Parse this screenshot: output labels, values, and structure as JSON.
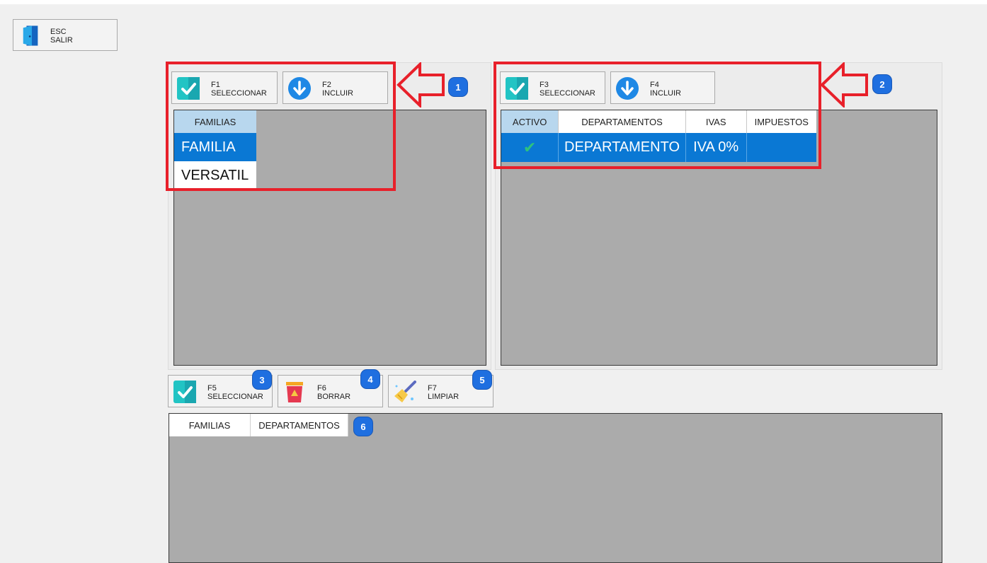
{
  "exit_button": {
    "key": "ESC",
    "label": "SALIR",
    "icon": "door-exit-icon"
  },
  "families_panel": {
    "select_button": {
      "key": "F1",
      "label": "SELECCIONAR",
      "icon": "check-icon"
    },
    "include_button": {
      "key": "F2",
      "label": "INCLUIR",
      "icon": "arrow-down-icon"
    },
    "table": {
      "header": "FAMILIAS",
      "rows": [
        "FAMILIA",
        "VERSATIL"
      ],
      "selected_index": 0
    }
  },
  "departments_panel": {
    "select_button": {
      "key": "F3",
      "label": "SELECCIONAR",
      "icon": "check-icon"
    },
    "include_button": {
      "key": "F4",
      "label": "INCLUIR",
      "icon": "arrow-down-icon"
    },
    "table": {
      "columns": [
        "ACTIVO",
        "DEPARTAMENTOS",
        "IVAS",
        "IMPUESTOS"
      ],
      "rows": [
        {
          "activo": "✔",
          "departamento": "DEPARTAMENTO",
          "iva": "IVA 0%",
          "impuestos": ""
        }
      ]
    }
  },
  "bottom_toolbar": {
    "select_button": {
      "key": "F5",
      "label": "SELECCIONAR",
      "icon": "check-icon"
    },
    "delete_button": {
      "key": "F6",
      "label": "BORRAR",
      "icon": "trash-bin-icon"
    },
    "clear_button": {
      "key": "F7",
      "label": "LIMPIAR",
      "icon": "broom-icon"
    }
  },
  "result_grid": {
    "columns": [
      "FAMILIAS",
      "DEPARTAMENTOS"
    ]
  },
  "annotations": {
    "badges": [
      "1",
      "2",
      "3",
      "4",
      "5",
      "6"
    ],
    "callout_color": "#e8202a",
    "badge_color": "#1f6fe0"
  },
  "colors": {
    "selection_blue": "#0a78d4",
    "header_blue": "#b8d7ee",
    "grid_gray": "#ababab",
    "check_green": "#2ec27e"
  }
}
